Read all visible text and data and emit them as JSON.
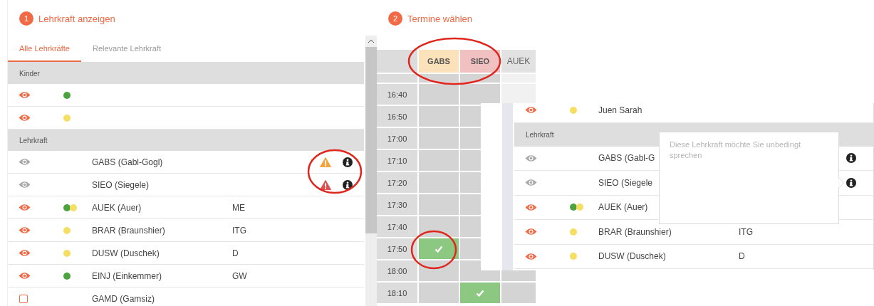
{
  "teacher_panel": {
    "step": "1",
    "title": "Lehrkraft anzeigen",
    "tabs": [
      {
        "label": "Alle Lehrkräfte",
        "selected": true
      },
      {
        "label": "Relevante Lehrkraft",
        "selected": false
      }
    ],
    "items": [
      {
        "kind": "header",
        "label": "Kinder"
      },
      {
        "kind": "eye",
        "visible": true,
        "dots": [
          {
            "color": "#4aa33c"
          }
        ]
      },
      {
        "kind": "eye",
        "visible": true,
        "dots": [
          {
            "color": "#f6de62"
          }
        ]
      },
      {
        "kind": "header",
        "label": "Lehrkraft"
      },
      {
        "kind": "eye",
        "visible": false,
        "name": "GABS (Gabl-Gogl)",
        "alert": {
          "color": "#f3a43c"
        },
        "info": true
      },
      {
        "kind": "eye",
        "visible": false,
        "name": "SIEO (Siegele)",
        "alert": {
          "color": "#dc5050"
        },
        "info": true
      },
      {
        "kind": "eye",
        "visible": true,
        "dots": [
          {
            "color": "#4aa33c"
          },
          {
            "color": "#f6de62"
          }
        ],
        "name": "AUEK (Auer)",
        "subject": "ME"
      },
      {
        "kind": "eye",
        "visible": true,
        "dots": [
          {
            "color": "#f6de62"
          }
        ],
        "name": "BRAR (Braunshier)",
        "subject": "ITG"
      },
      {
        "kind": "eye",
        "visible": true,
        "dots": [
          {
            "color": "#f6de62"
          }
        ],
        "name": "DUSW (Duschek)",
        "subject": "D"
      },
      {
        "kind": "eye",
        "visible": true,
        "dots": [
          {
            "color": "#4aa33c"
          }
        ],
        "name": "EINJ (Einkemmer)",
        "subject": "GW"
      },
      {
        "kind": "checkbox",
        "checked": false,
        "name": "GAMD (Gamsiz)"
      }
    ]
  },
  "schedule_panel": {
    "step": "2",
    "title": "Termine wählen",
    "columns": [
      {
        "label": "GABS",
        "color": "#fbe2bb"
      },
      {
        "label": "SIEO",
        "color": "#f1c1c1"
      },
      {
        "label": "AUEK",
        "color": "#e2e2e2"
      }
    ],
    "rows": [
      {
        "cells": [
          {
            "kind": "free"
          },
          {
            "kind": "free"
          },
          {
            "kind": "closed"
          }
        ]
      },
      {
        "time": "16:40",
        "cells": [
          {
            "kind": "free"
          },
          {
            "kind": "free"
          },
          {
            "kind": "closed"
          }
        ]
      },
      {
        "time": "16:50",
        "cells": [
          {
            "kind": "free"
          },
          {
            "kind": "free"
          }
        ]
      },
      {
        "time": "17:00",
        "cells": [
          {
            "kind": "free"
          },
          {
            "kind": "free"
          }
        ]
      },
      {
        "time": "17:10",
        "cells": [
          {
            "kind": "free"
          },
          {
            "kind": "free"
          }
        ]
      },
      {
        "time": "17:20",
        "cells": [
          {
            "kind": "free"
          },
          {
            "kind": "free"
          }
        ]
      },
      {
        "time": "17:30",
        "cells": [
          {
            "kind": "free"
          },
          {
            "kind": "free"
          }
        ]
      },
      {
        "time": "17:40",
        "cells": [
          {
            "kind": "free"
          },
          {
            "kind": "free"
          }
        ]
      },
      {
        "time": "17:50",
        "cells": [
          {
            "kind": "booked"
          },
          {
            "kind": "free"
          }
        ]
      },
      {
        "time": "18:00",
        "cells": [
          {
            "kind": "free"
          },
          {
            "kind": "free"
          },
          {
            "kind": "free"
          }
        ]
      },
      {
        "time": "18:10",
        "cells": [
          {
            "kind": "free"
          },
          {
            "kind": "booked"
          },
          {
            "kind": "free"
          }
        ]
      }
    ]
  },
  "detail_panel": {
    "items": [
      {
        "kind": "eye",
        "visible": true,
        "dots": [
          {
            "color": "#f6de62"
          }
        ],
        "name": "Juen Sarah"
      },
      {
        "kind": "header",
        "label": "Lehrkraft"
      },
      {
        "kind": "eye",
        "visible": false,
        "name": "GABS (Gabl-G",
        "info": true
      },
      {
        "kind": "eye",
        "visible": false,
        "name": "SIEO (Siegele",
        "info": true
      },
      {
        "kind": "eye",
        "visible": true,
        "dots": [
          {
            "color": "#4aa33c"
          },
          {
            "color": "#f6de62"
          }
        ],
        "name": "AUEK (Auer)"
      },
      {
        "kind": "eye",
        "visible": true,
        "dots": [
          {
            "color": "#f6de62"
          }
        ],
        "name": "BRAR (Braunshier)",
        "subject": "ITG"
      },
      {
        "kind": "eye",
        "visible": true,
        "dots": [
          {
            "color": "#f6de62"
          }
        ],
        "name": "DUSW (Duschek)",
        "subject": "D"
      }
    ],
    "tooltip": "Diese Lehrkraft möchte Sie unbedingt sprechen"
  },
  "highlights": [
    {
      "kind": "alerts"
    },
    {
      "kind": "columns"
    },
    {
      "kind": "slot"
    }
  ]
}
